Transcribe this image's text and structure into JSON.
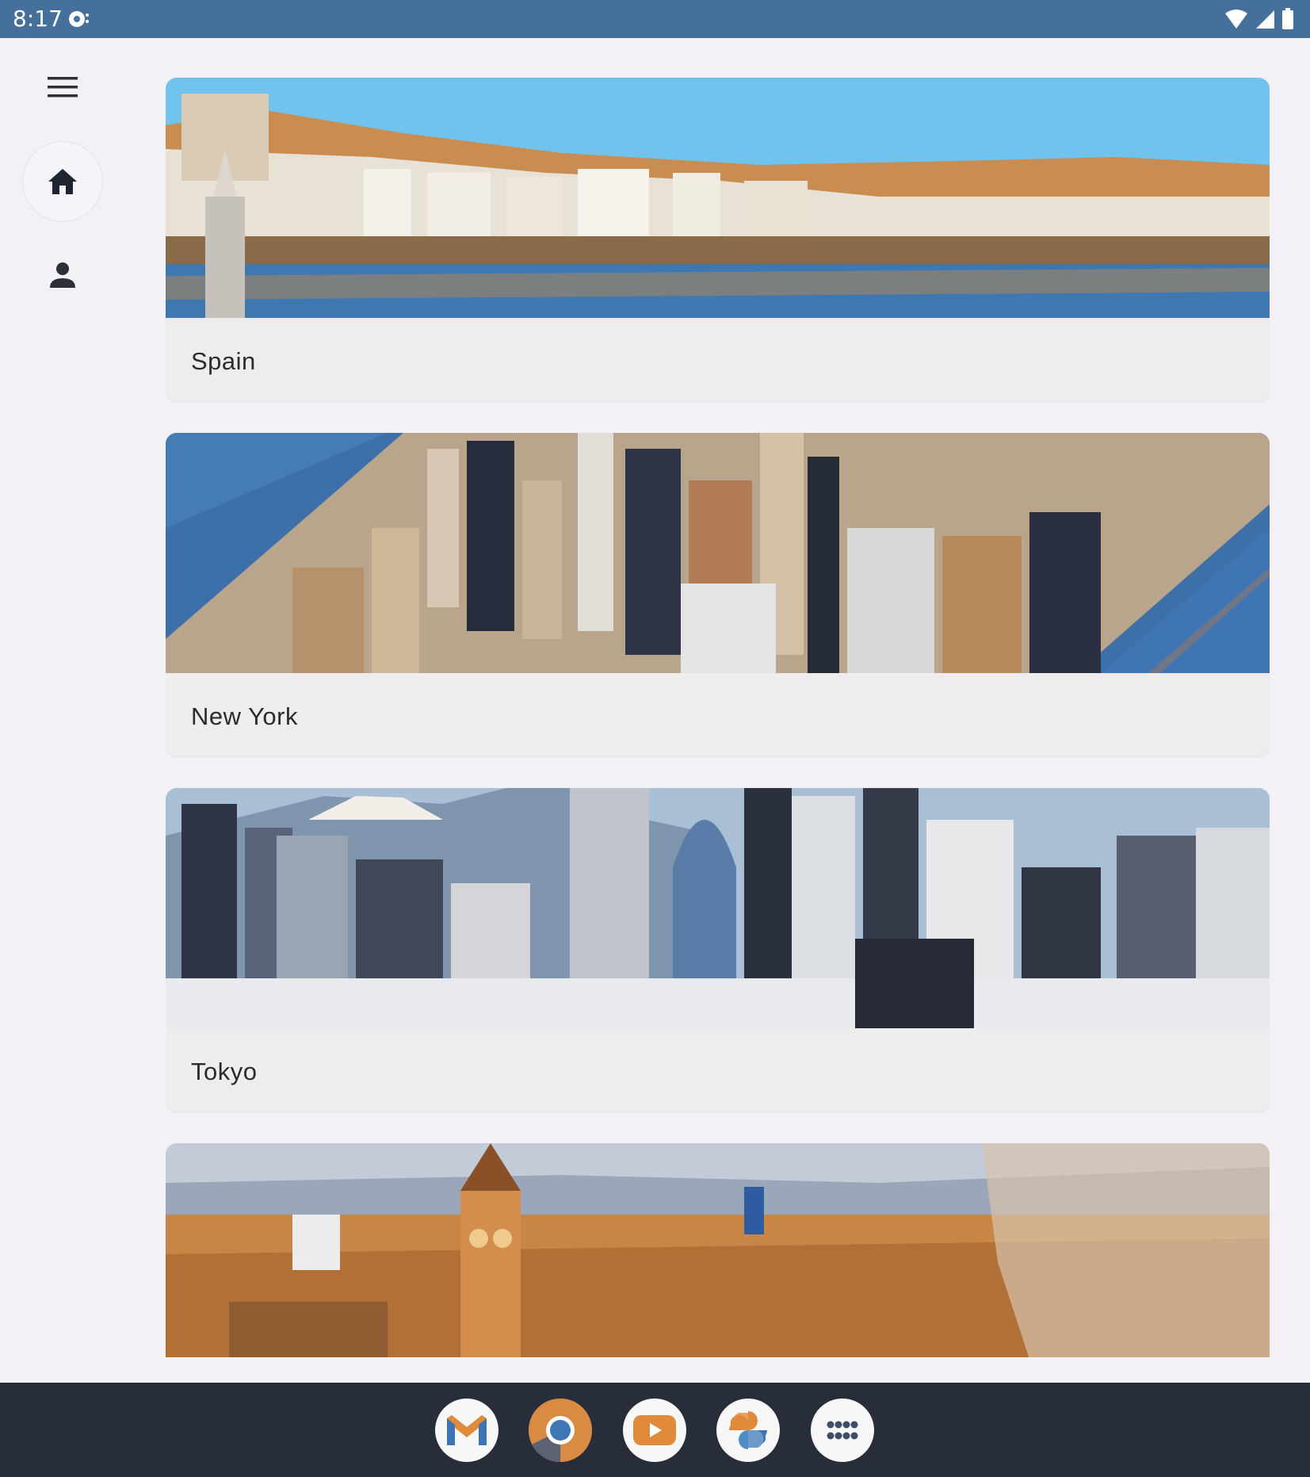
{
  "status_bar": {
    "time": "8:17",
    "icons": [
      "notification-icon",
      "wifi-icon",
      "cellular-signal-icon",
      "battery-icon"
    ],
    "background": "#44709b"
  },
  "nav_rail": {
    "items": [
      {
        "name": "menu",
        "icon": "menu-icon"
      },
      {
        "name": "home",
        "icon": "home-icon",
        "selected": true
      },
      {
        "name": "profile",
        "icon": "person-icon"
      }
    ]
  },
  "cards": [
    {
      "label": "Spain",
      "image": "spain-coastal-town-photo"
    },
    {
      "label": "New York",
      "image": "new-york-skyline-photo"
    },
    {
      "label": "Tokyo",
      "image": "tokyo-skyline-photo"
    },
    {
      "label": "",
      "image": "european-city-clocktower-photo"
    }
  ],
  "dock": {
    "apps": [
      {
        "name": "gmail",
        "icon": "gmail-icon"
      },
      {
        "name": "chrome",
        "icon": "chrome-icon"
      },
      {
        "name": "youtube",
        "icon": "youtube-icon"
      },
      {
        "name": "photos",
        "icon": "pinwheel-photos-icon"
      },
      {
        "name": "app-drawer",
        "icon": "app-grid-icon"
      }
    ],
    "background": "#282d3a"
  }
}
